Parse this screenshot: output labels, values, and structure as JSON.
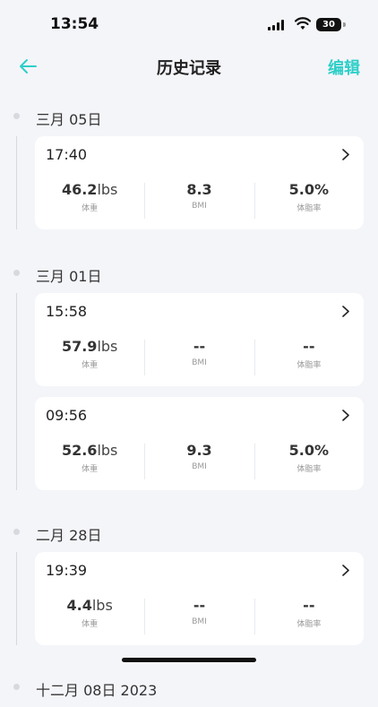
{
  "status": {
    "time": "13:54",
    "battery": "30"
  },
  "nav": {
    "title": "历史记录",
    "edit_label": "编辑"
  },
  "groups": [
    {
      "date": "三月 05日",
      "records": [
        {
          "time": "17:40",
          "weight": "46.2",
          "weight_unit": "lbs",
          "bmi": "8.3",
          "body_fat": "5.0%"
        }
      ]
    },
    {
      "date": "三月 01日",
      "records": [
        {
          "time": "15:58",
          "weight": "57.9",
          "weight_unit": "lbs",
          "bmi": "--",
          "body_fat": "--"
        },
        {
          "time": "09:56",
          "weight": "52.6",
          "weight_unit": "lbs",
          "bmi": "9.3",
          "body_fat": "5.0%"
        }
      ]
    },
    {
      "date": "二月 28日",
      "records": [
        {
          "time": "19:39",
          "weight": "4.4",
          "weight_unit": "lbs",
          "bmi": "--",
          "body_fat": "--"
        }
      ]
    },
    {
      "date": "十二月 08日 2023",
      "records": []
    }
  ],
  "labels": {
    "weight": "体重",
    "bmi": "BMI",
    "body_fat": "体脂率"
  },
  "colors": {
    "accent": "#2ecfc8",
    "background": "#f4f5f9"
  }
}
